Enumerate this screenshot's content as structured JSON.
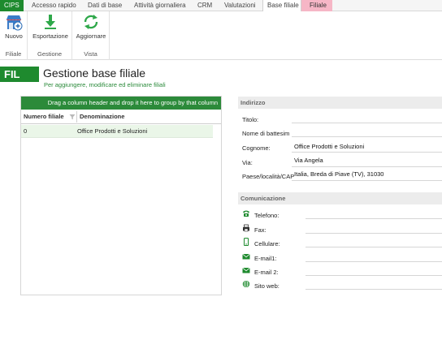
{
  "ribbon_tabs": {
    "cips": "CIPS",
    "accesso_rapido": "Accesso rapido",
    "dati_di_base": "Dati di base",
    "attivita_giornaliera": "Attività giornaliera",
    "crm": "CRM",
    "valutazioni": "Valutazioni",
    "base_filiale": "Base filiale",
    "filiale": "Filiale"
  },
  "ribbon": {
    "nuovo": "Nuovo",
    "esportazione": "Esportazione",
    "aggiornare": "Aggiornare",
    "group_filiale": "Filiale",
    "group_gestione": "Gestione",
    "group_vista": "Vista"
  },
  "header": {
    "badge": "FIL",
    "title": "Gestione base filiale",
    "subtitle": "Per aggiungere, modificare ed eliminare filiali"
  },
  "grid": {
    "group_hint": "Drag a column header and drop it here to group by that column",
    "columns": [
      "Numero filiale",
      "Denominazione"
    ],
    "rows": [
      {
        "numero": "0",
        "denominazione": "Office Prodotti e Soluzioni"
      }
    ]
  },
  "indirizzo": {
    "title": "Indirizzo",
    "labels": {
      "titolo": "Titolo:",
      "nome": "Nome di battesim",
      "cognome": "Cognome:",
      "via": "Via:",
      "paese": "Paese/località/CAP"
    },
    "values": {
      "titolo": "",
      "nome": "",
      "cognome": "Office Prodotti e Soluzioni",
      "via": "Via Angela",
      "paese": "Italia, Breda di Piave (TV), 31030"
    }
  },
  "comunicazione": {
    "title": "Comunicazione",
    "labels": {
      "telefono": "Telefono:",
      "fax": "Fax:",
      "cellulare": "Cellulare:",
      "email1": "E-mail1:",
      "email2": "E-mail 2:",
      "sito": "Sito web:"
    }
  },
  "colors": {
    "brand_green": "#1e8a2e",
    "tab_pink": "#f6b6c6",
    "selected_row": "#eaf6e8"
  }
}
